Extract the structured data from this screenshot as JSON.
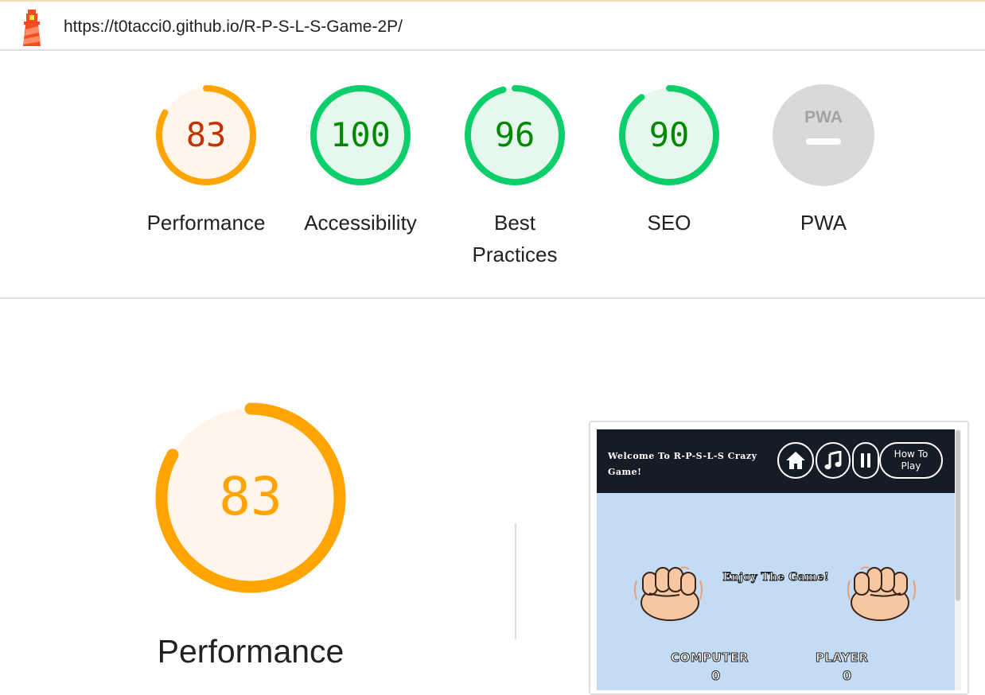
{
  "url": "https://t0tacci0.github.io/R-P-S-L-S-Game-2P/",
  "colors": {
    "average": "#ffa400",
    "average_text": "#c33300",
    "pass": "#0cce6b",
    "pass_text": "#008800",
    "na": "#d9d9d9"
  },
  "gauges": [
    {
      "label": "Performance",
      "score": "83",
      "status": "average"
    },
    {
      "label": "Accessibility",
      "score": "100",
      "status": "pass"
    },
    {
      "label": "Best Practices",
      "score": "96",
      "status": "pass"
    },
    {
      "label": "SEO",
      "score": "90",
      "status": "pass"
    },
    {
      "label": "PWA",
      "score": "",
      "status": "na",
      "badge": "PWA"
    }
  ],
  "performance": {
    "score": "83",
    "title": "Performance"
  },
  "screenshot": {
    "welcome": "Welcome To R-P-S-L-S Crazy Game!",
    "how_to_play": "How To Play",
    "enjoy": "Enjoy The Game!",
    "computer_label": "COMPUTER",
    "player_label": "PLAYER",
    "computer_score": "0",
    "player_score": "0",
    "icons": [
      "home-icon",
      "music-icon",
      "pause-icon"
    ]
  }
}
